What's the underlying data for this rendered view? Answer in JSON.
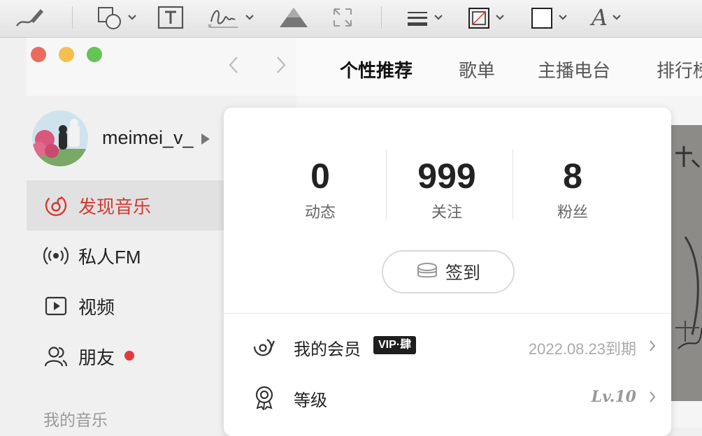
{
  "toolbar": {
    "tools": [
      "sketch-icon",
      "shapes-icon",
      "text-box-icon",
      "signature-icon",
      "adjust-color-icon",
      "resize-icon",
      "line-style-icon",
      "border-color-icon",
      "fill-color-icon",
      "text-style-icon"
    ],
    "text_style_glyph": "A"
  },
  "window": {
    "traffic_lights": {
      "close": "#ed6a5e",
      "minimize": "#f5bf4f",
      "zoom": "#62c554"
    }
  },
  "nav": {
    "tabs": [
      {
        "label": "个性推荐",
        "active": true
      },
      {
        "label": "歌单",
        "active": false
      },
      {
        "label": "主播电台",
        "active": false
      },
      {
        "label": "排行榜",
        "active": false
      }
    ]
  },
  "user": {
    "name": "meimei_v_"
  },
  "sidebar": {
    "items": [
      {
        "label": "发现音乐",
        "icon": "netease-music-icon",
        "active": true
      },
      {
        "label": "私人FM",
        "icon": "radio-icon",
        "active": false
      },
      {
        "label": "视频",
        "icon": "video-icon",
        "active": false
      },
      {
        "label": "朋友",
        "icon": "friends-icon",
        "active": false
      }
    ],
    "section_my_music": "我的音乐"
  },
  "card": {
    "stats": [
      {
        "value": "0",
        "label": "动态"
      },
      {
        "value": "999",
        "label": "关注"
      },
      {
        "value": "8",
        "label": "粉丝"
      }
    ],
    "signin_label": "签到",
    "membership": {
      "label": "我的会员",
      "badge": "VIP·肆",
      "expiry": "2022.08.23到期"
    },
    "level": {
      "label": "等级",
      "value": "Lv.10"
    }
  },
  "colors": {
    "accent": "#d33a31",
    "notification_dot": "#e03b3b"
  }
}
